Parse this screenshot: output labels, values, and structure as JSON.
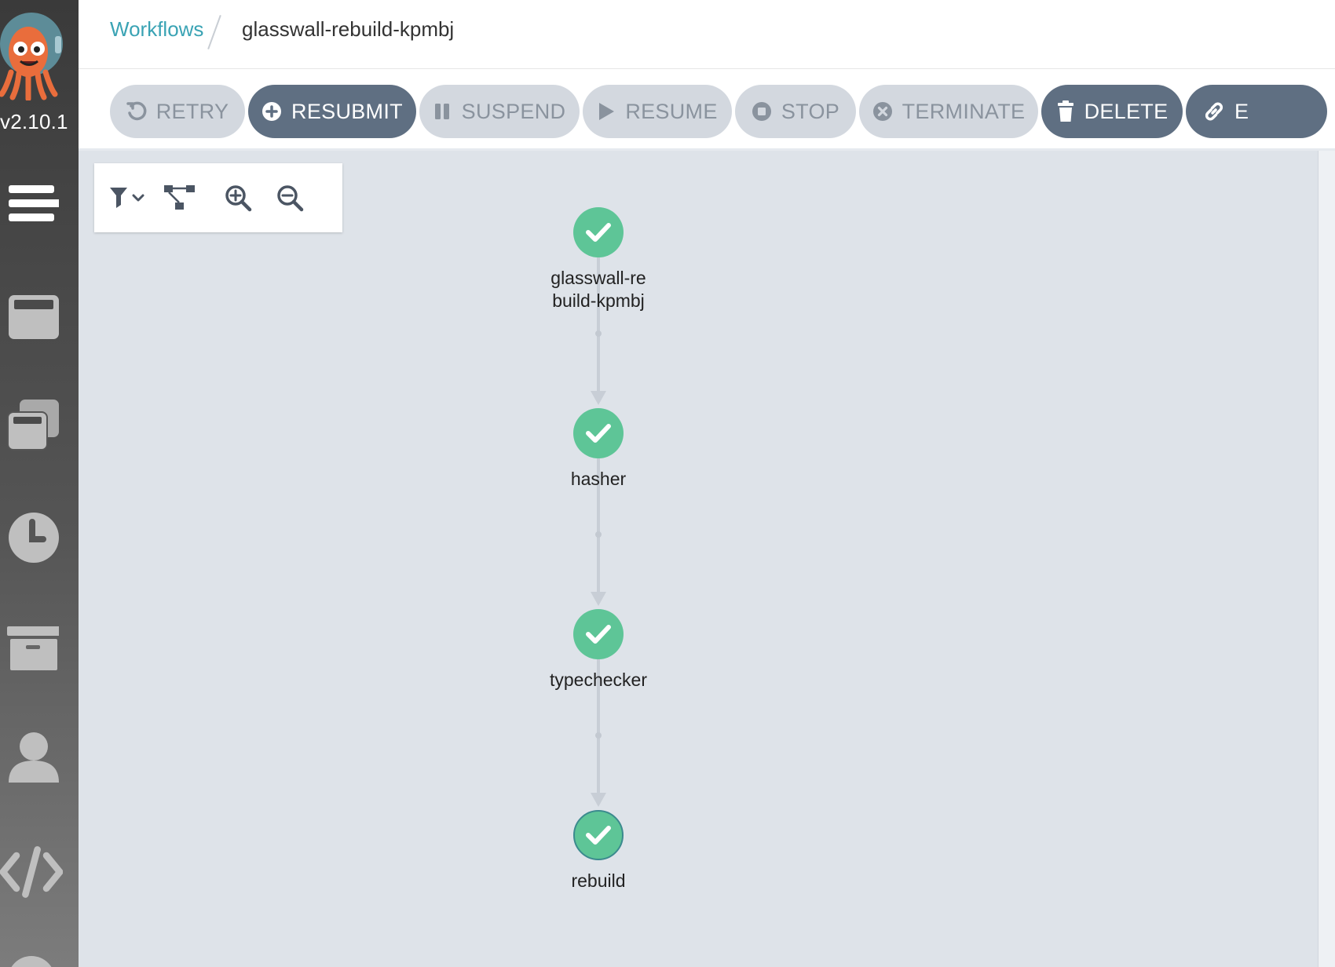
{
  "app": {
    "version": "v2.10.1"
  },
  "breadcrumb": {
    "parent": "Workflows",
    "current": "glasswall-rebuild-kpmbj"
  },
  "toolbar": {
    "retry": "RETRY",
    "resubmit": "RESUBMIT",
    "suspend": "SUSPEND",
    "resume": "RESUME",
    "stop": "STOP",
    "terminate": "TERMINATE",
    "delete": "DELETE",
    "link": "E"
  },
  "sidebar": {
    "items": [
      {
        "icon": "menu-icon"
      },
      {
        "icon": "workflows-icon"
      },
      {
        "icon": "workflow-templates-icon"
      },
      {
        "icon": "cron-workflows-icon"
      },
      {
        "icon": "archive-icon"
      },
      {
        "icon": "user-icon"
      },
      {
        "icon": "api-docs-icon"
      }
    ]
  },
  "graph": {
    "tools": [
      "filter-icon",
      "layout-icon",
      "zoom-in-icon",
      "zoom-out-icon"
    ],
    "nodes": [
      {
        "label": "glasswall-rebuild-kpmbj",
        "status": "succeeded"
      },
      {
        "label": "hasher",
        "status": "succeeded"
      },
      {
        "label": "typechecker",
        "status": "succeeded"
      },
      {
        "label": "rebuild",
        "status": "succeeded"
      }
    ]
  },
  "colors": {
    "accent": "#3aa3b4",
    "success": "#5ec597",
    "button_dark": "#5f6f82",
    "button_light": "#d3d8df"
  }
}
